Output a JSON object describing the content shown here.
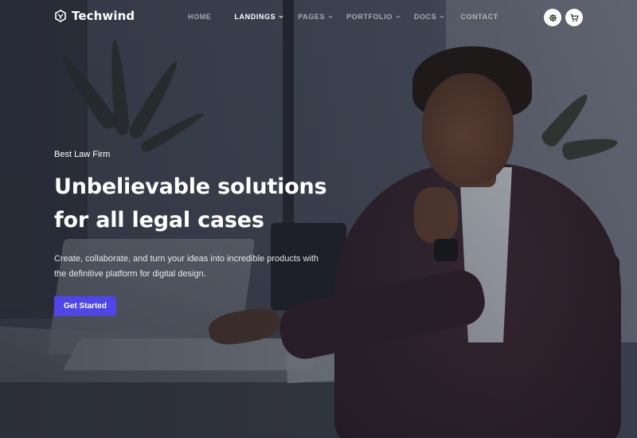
{
  "brand": {
    "name": "Techwind",
    "logo_icon": "techwind-logo-icon"
  },
  "nav": {
    "items": [
      {
        "label": "HOME",
        "dropdown": false,
        "active": false
      },
      {
        "label": "LANDINGS",
        "dropdown": true,
        "active": true
      },
      {
        "label": "PAGES",
        "dropdown": true,
        "active": false
      },
      {
        "label": "PORTFOLIO",
        "dropdown": true,
        "active": false
      },
      {
        "label": "DOCS",
        "dropdown": true,
        "active": false
      },
      {
        "label": "CONTACT",
        "dropdown": false,
        "active": false
      }
    ],
    "icons": [
      "settings-gear-icon",
      "shopping-cart-icon"
    ]
  },
  "hero": {
    "eyebrow": "Best Law Firm",
    "title_line1": "Unbelievable solutions",
    "title_line2": "for all legal cases",
    "desc_line1": "Create, collaborate, and turn your ideas into incredible products with",
    "desc_line2": "the definitive platform for digital design.",
    "cta_label": "Get Started"
  },
  "colors": {
    "accent": "#4f46e5",
    "text": "#ffffff",
    "muted_nav": "rgba(255,255,255,0.55)"
  }
}
